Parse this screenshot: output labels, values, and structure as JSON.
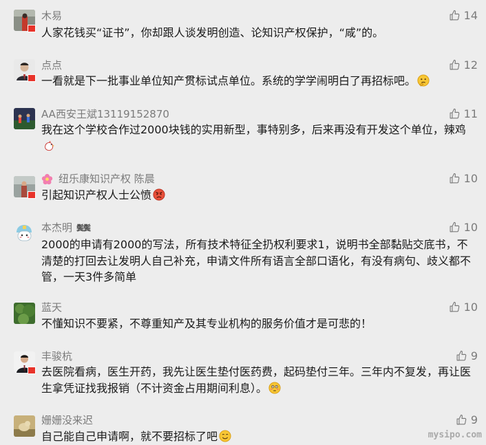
{
  "comments": [
    {
      "user": "木易",
      "likes": "14",
      "text": "人家花钱买“证书”，你却跟人谈发明创造、论知识产权保护，“咸”的。"
    },
    {
      "user": "点点",
      "likes": "12",
      "text": "一看就是下一批事业单位知产贯标试点单位。系统的学学闹明白了再招标吧。",
      "emoji": "thinking-face"
    },
    {
      "user": "AA西安王斌13119152870",
      "likes": "11",
      "text": "我在这个学校合作过2000块钱的实用新型，事特别多，后来再没有开发这个单位，辣鸡",
      "emoji": "chicken"
    },
    {
      "user": "纽乐康知识产权 陈晨",
      "likes": "10",
      "text": "引起知识产权人士公愤",
      "emoji": "angry-face"
    },
    {
      "user": "本杰明",
      "medal": "鬓鬓",
      "likes": "10",
      "text": "2000的申请有2000的写法，所有技术特征全扔权利要求1，说明书全部黏贴交底书，不清楚的打回去让发明人自己补充，申请文件所有语言全部口语化，有没有病句、歧义都不管，一天3件多简单"
    },
    {
      "user": "蓝天",
      "likes": "10",
      "text": "不懂知识不要紧，不尊重知产及其专业机构的服务价值才是可悲的！"
    },
    {
      "user": "丰骏杭",
      "likes": "9",
      "text": "去医院看病，医生开药，我先让医生垫付医药费，起码垫付三年。三年内不复发，再让医生拿凭证找我报销（不计资金占用期间利息）。",
      "emoji": "flushed-face"
    },
    {
      "user": "姗姗没来迟",
      "likes": "9",
      "text": "自己能自己申请啊，就不要招标了吧",
      "emoji": "smiling-face"
    }
  ],
  "watermark": "mysipo.com",
  "colors": {
    "background": "#ededed",
    "nickname": "#7b7b7b",
    "text": "#1a1a1a",
    "flag": "#e8332a"
  }
}
